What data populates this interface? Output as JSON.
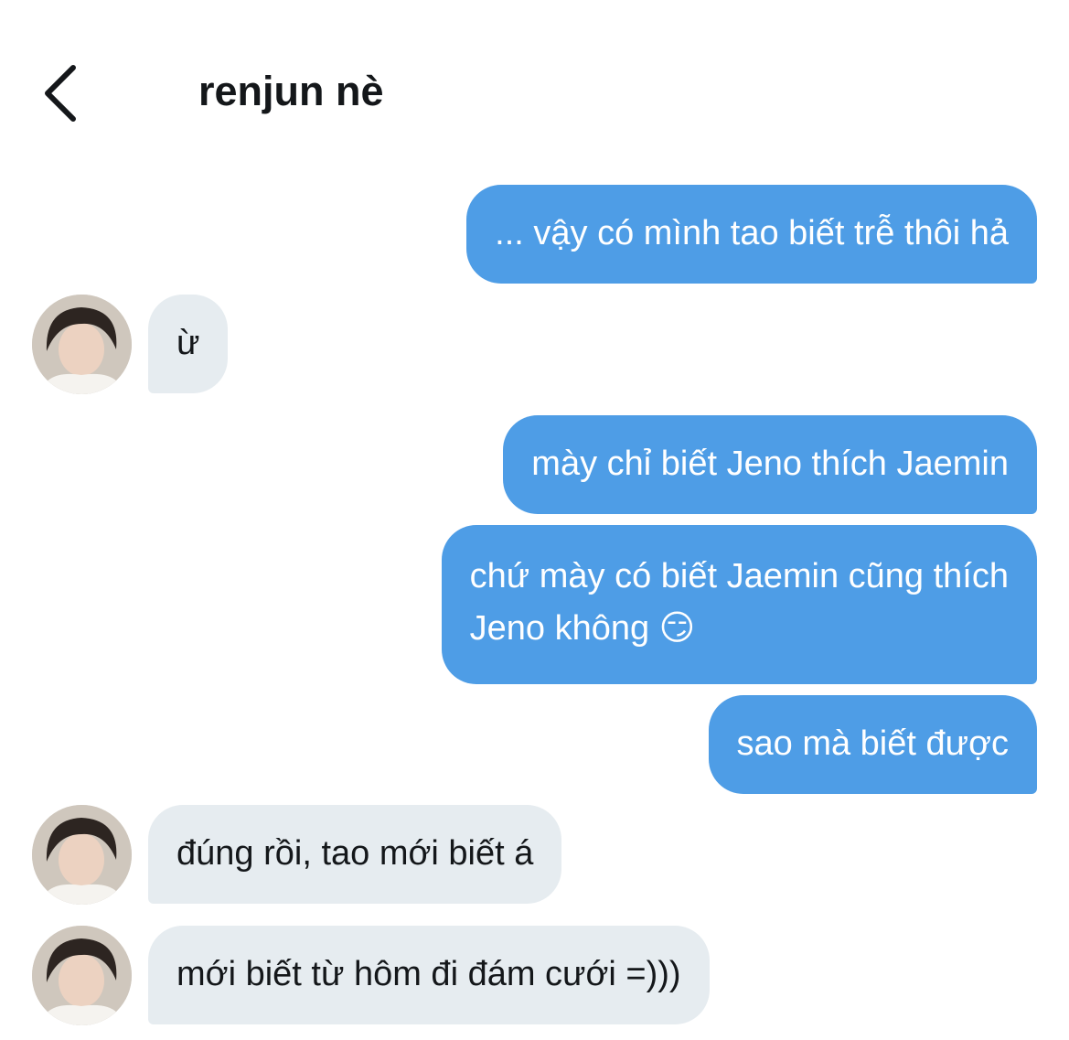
{
  "header": {
    "title": "renjun nè"
  },
  "icons": {
    "back": "chevron-left-icon",
    "avatar": "contact-avatar"
  },
  "colors": {
    "outgoing_bubble": "#4e9de6",
    "incoming_bubble": "#e6ecf0",
    "outgoing_text": "#ffffff",
    "incoming_text": "#14171a"
  },
  "messages": [
    {
      "direction": "out",
      "lines": [
        "... vậy có mình tao biết trễ thôi hả"
      ]
    },
    {
      "direction": "in",
      "lines": [
        "ừ"
      ]
    },
    {
      "direction": "out",
      "lines": [
        "mày chỉ biết Jeno thích Jaemin"
      ]
    },
    {
      "direction": "out",
      "lines": [
        "chứ mày có biết Jaemin cũng thích",
        "Jeno không 😏"
      ]
    },
    {
      "direction": "out",
      "lines": [
        "sao mà biết được"
      ]
    },
    {
      "direction": "in",
      "lines": [
        "đúng rồi, tao mới biết á"
      ]
    },
    {
      "direction": "in",
      "lines": [
        "mới biết từ hôm đi đám cưới =)))"
      ]
    }
  ]
}
